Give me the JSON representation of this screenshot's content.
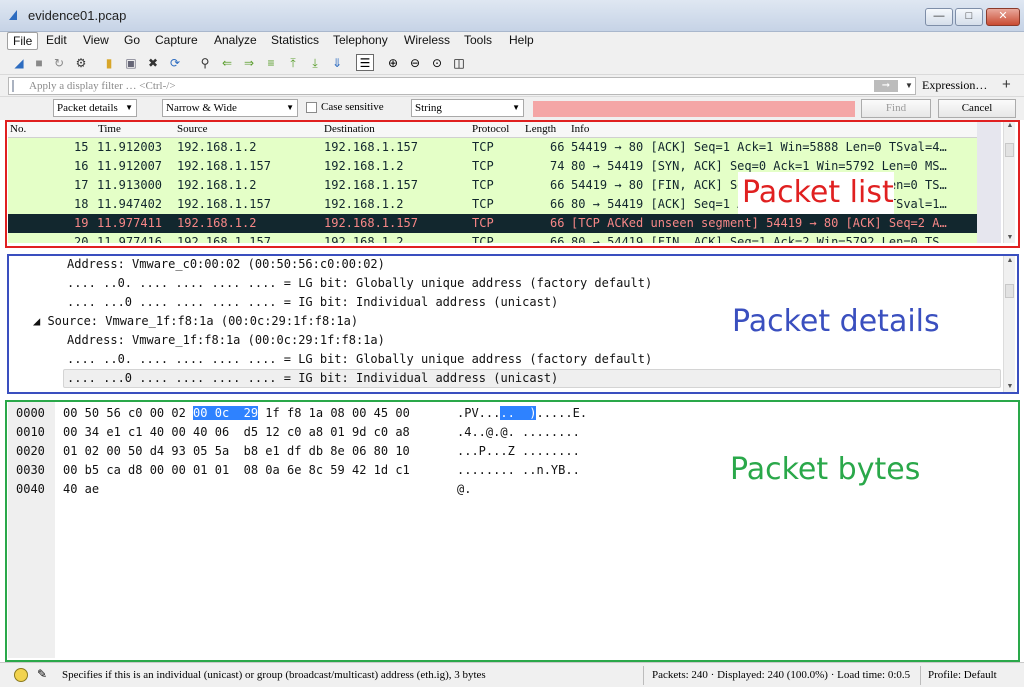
{
  "window": {
    "title": "evidence01.pcap"
  },
  "menubar": [
    "File",
    "Edit",
    "View",
    "Go",
    "Capture",
    "Analyze",
    "Statistics",
    "Telephony",
    "Wireless",
    "Tools",
    "Help"
  ],
  "filter": {
    "placeholder": "Apply a display filter … <Ctrl-/>",
    "arrow": "➞",
    "expression_label": "Expression…",
    "plus": "+"
  },
  "findbar": {
    "search_in": "Packet details",
    "char_width": "Narrow & Wide",
    "case_label": "Case sensitive",
    "search_type": "String",
    "find_label": "Find",
    "cancel_label": "Cancel"
  },
  "packet_list": {
    "columns": [
      "No.",
      "Time",
      "Source",
      "Destination",
      "Protocol",
      "Length",
      "Info"
    ],
    "rows": [
      {
        "no": "15",
        "time": "11.912003",
        "src": "192.168.1.2",
        "dst": "192.168.1.157",
        "proto": "TCP",
        "len": "66",
        "info": "54419 → 80 [ACK] Seq=1 Ack=1 Win=5888 Len=0 TSval=4…"
      },
      {
        "no": "16",
        "time": "11.912007",
        "src": "192.168.1.157",
        "dst": "192.168.1.2",
        "proto": "TCP",
        "len": "74",
        "info": "80 → 54419 [SYN, ACK] Seq=0 Ack=1 Win=5792 Len=0 MS…"
      },
      {
        "no": "17",
        "time": "11.913000",
        "src": "192.168.1.2",
        "dst": "192.168.1.157",
        "proto": "TCP",
        "len": "66",
        "info": "54419 → 80 [FIN, ACK] Seq=1 Ack=1 Win=5888 Len=0 TS…"
      },
      {
        "no": "18",
        "time": "11.947402",
        "src": "192.168.1.157",
        "dst": "192.168.1.2",
        "proto": "TCP",
        "len": "66",
        "info": "80 → 54419 [ACK] Seq=1 Ack=2 Win=5792 Len=0 TSval=1…"
      },
      {
        "no": "19",
        "time": "11.977411",
        "src": "192.168.1.2",
        "dst": "192.168.1.157",
        "proto": "TCP",
        "len": "66",
        "info": "[TCP ACKed unseen segment] 54419 → 80 [ACK] Seq=2 A…"
      },
      {
        "no": "20",
        "time": "11.977416",
        "src": "192.168.1.157",
        "dst": "192.168.1.2",
        "proto": "TCP",
        "len": "66",
        "info": "80 → 54419 [FIN, ACK] Seq=1 Ack=2 Win=5792 Len=0 TS…"
      }
    ]
  },
  "packet_details": {
    "lines": [
      "Address: Vmware_c0:00:02 (00:50:56:c0:00:02)",
      ".... ..0. .... .... .... .... = LG bit: Globally unique address (factory default)",
      ".... ...0 .... .... .... .... = IG bit: Individual address (unicast)",
      "◢ Source: Vmware_1f:f8:1a (00:0c:29:1f:f8:1a)",
      "Address: Vmware_1f:f8:1a (00:0c:29:1f:f8:1a)",
      ".... ..0. .... .... .... .... = LG bit: Globally unique address (factory default)",
      ".... ...0 .... .... .... .... = IG bit: Individual address (unicast)"
    ]
  },
  "packet_bytes": {
    "offsets": [
      "0000",
      "0010",
      "0020",
      "0030",
      "0040"
    ],
    "rows": [
      {
        "h1": "00 50 56 c0 00 02 ",
        "hl_hex": "00 0c  29",
        "h2": " 1f f8 1a 08 00 45 00",
        "a1": ".PV...",
        "hl_ascii": "..  )",
        "a2": ".....E."
      },
      {
        "h1": "00 34 e1 c1 40 00 40 06  d5 12 c0 a8 01 9d c0 a8",
        "hl_hex": "",
        "h2": "",
        "a1": ".4..@.@. ........",
        "hl_ascii": "",
        "a2": ""
      },
      {
        "h1": "01 02 00 50 d4 93 05 5a  b8 e1 df db 8e 06 80 10",
        "hl_hex": "",
        "h2": "",
        "a1": "...P...Z ........",
        "hl_ascii": "",
        "a2": ""
      },
      {
        "h1": "00 b5 ca d8 00 00 01 01  08 0a 6e 8c 59 42 1d c1",
        "hl_hex": "",
        "h2": "",
        "a1": "........ ..n.YB..",
        "hl_ascii": "",
        "a2": ""
      },
      {
        "h1": "40 ae",
        "hl_hex": "",
        "h2": "",
        "a1": "@.",
        "hl_ascii": "",
        "a2": ""
      }
    ]
  },
  "annotations": {
    "packet_list": {
      "label": "Packet list",
      "color": "#e02020"
    },
    "packet_details": {
      "label": "Packet details",
      "color": "#3a4fbf"
    },
    "packet_bytes": {
      "label": "Packet bytes",
      "color": "#2aa84a"
    }
  },
  "statusbar": {
    "message": "Specifies if this is an individual (unicast) or group (broadcast/multicast) address (eth.ig), 3 bytes",
    "packets": "Packets: 240 · Displayed: 240 (100.0%) · Load time: 0:0.5",
    "profile": "Profile: Default"
  }
}
